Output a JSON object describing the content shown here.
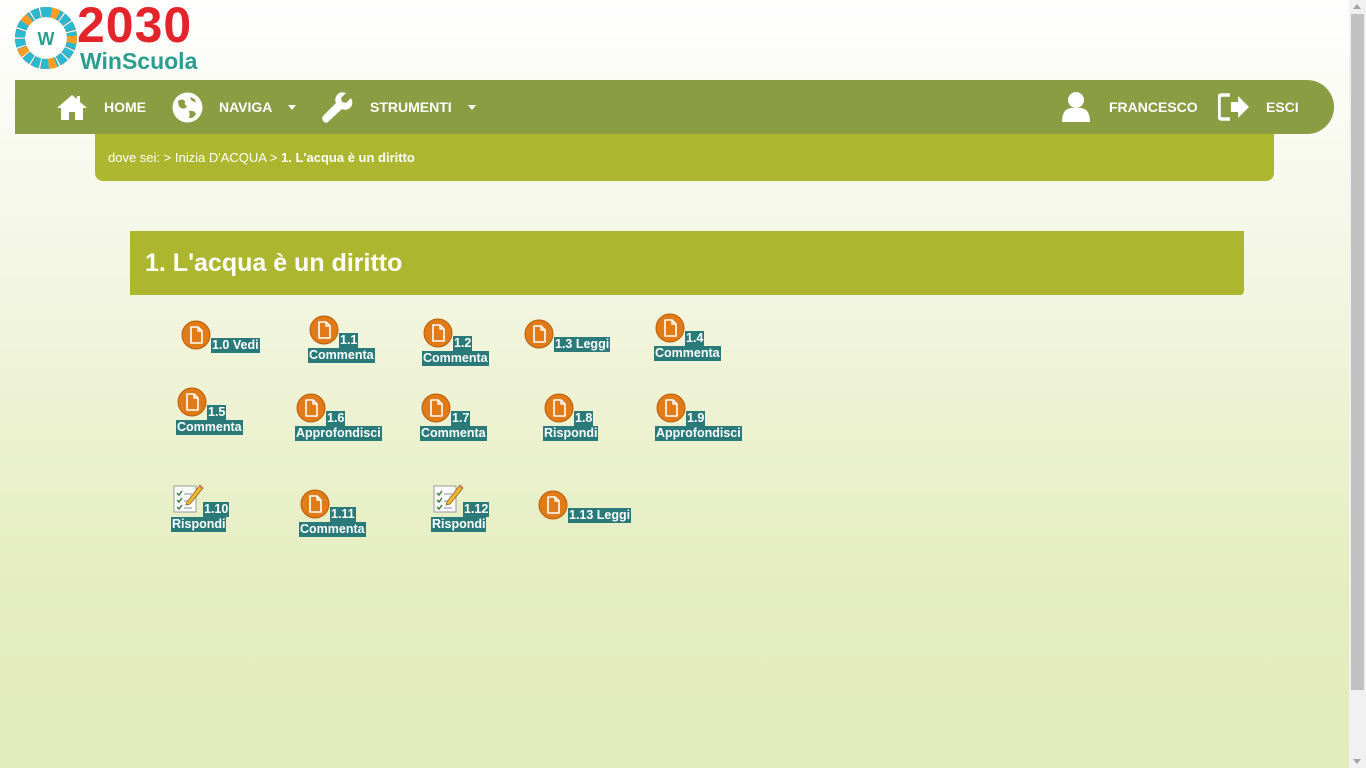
{
  "logo": {
    "year": "2030",
    "name": "WinScuola",
    "mark": "W"
  },
  "nav": {
    "home": "HOME",
    "naviga": "NAVIGA",
    "strumenti": "STRUMENTI",
    "user": "FRANCESCO",
    "exit": "ESCI"
  },
  "breadcrumb": {
    "prefix": "dove sei: > ",
    "parent": "Inizia D'ACQUA",
    "separator": " > ",
    "current": "1. L'acqua è un diritto"
  },
  "section": {
    "title": "1. L'acqua è un diritto"
  },
  "activities": [
    {
      "line1": "1.0 Vedi",
      "line2": "",
      "icon": "document-icon"
    },
    {
      "line1": "1.1",
      "line2": "Commenta",
      "icon": "document-icon"
    },
    {
      "line1": "1.2",
      "line2": "Commenta",
      "icon": "document-icon"
    },
    {
      "line1": "1.3 Leggi",
      "line2": "",
      "icon": "document-icon"
    },
    {
      "line1": "1.4",
      "line2": "Commenta",
      "icon": "document-icon"
    },
    {
      "line1": "1.5",
      "line2": "Commenta",
      "icon": "document-icon"
    },
    {
      "line1": "1.6",
      "line2": "Approfondisci",
      "icon": "document-icon"
    },
    {
      "line1": "1.7",
      "line2": "Commenta",
      "icon": "document-icon"
    },
    {
      "line1": "1.8",
      "line2": "Rispondi",
      "icon": "document-icon"
    },
    {
      "line1": "1.9",
      "line2": "Approfondisci",
      "icon": "document-icon"
    },
    {
      "line1": "1.10",
      "line2": "Rispondi",
      "icon": "checklist-icon"
    },
    {
      "line1": "1.11",
      "line2": "Commenta",
      "icon": "document-icon"
    },
    {
      "line1": "1.12",
      "line2": "Rispondi",
      "icon": "checklist-icon"
    },
    {
      "line1": "1.13 Leggi",
      "line2": "",
      "icon": "document-icon"
    }
  ],
  "colors": {
    "nav_bg": "#8b9d43",
    "section_bg": "#acb62e",
    "label_bg": "#2a7a7a",
    "doc_icon": "#e07b17",
    "logo_red": "#e3242b",
    "logo_teal": "#2a9d8f"
  }
}
